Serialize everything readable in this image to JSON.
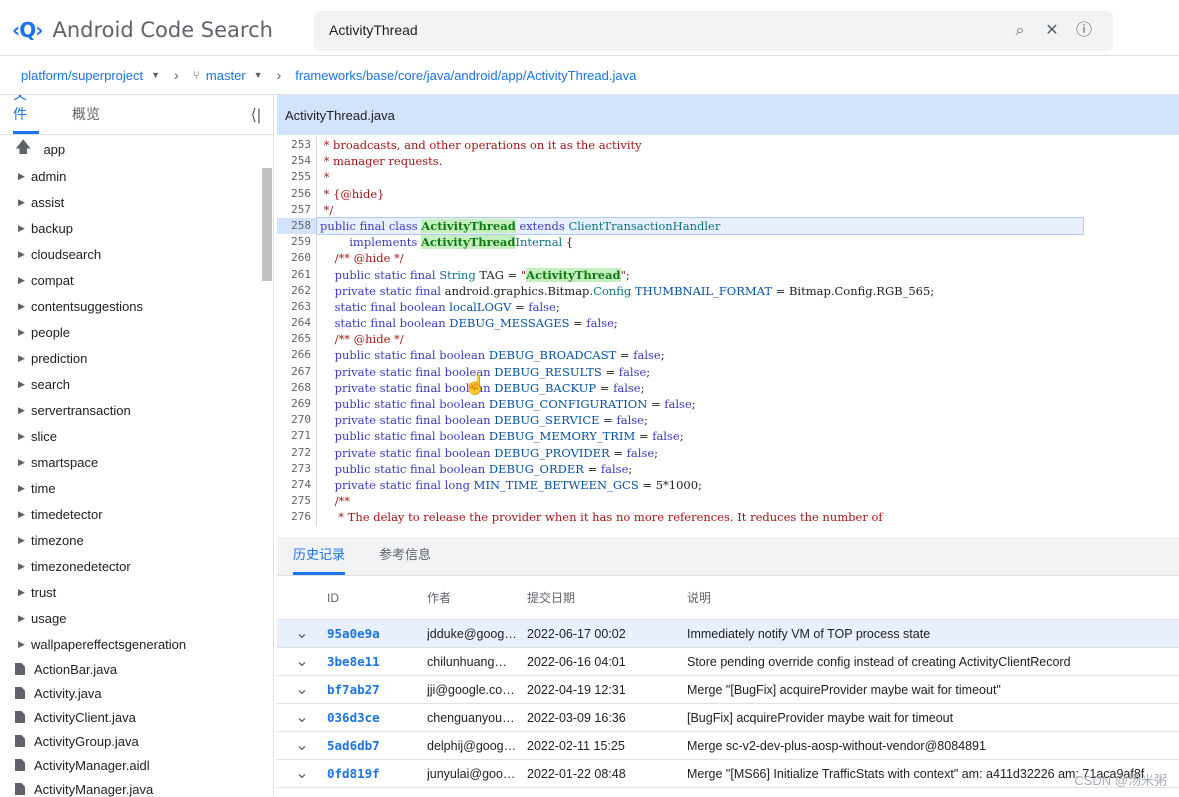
{
  "app": {
    "logo_icon": "‹Q›",
    "title": "Android Code Search"
  },
  "search": {
    "value": "ActivityThread",
    "search_icon": "⌕",
    "clear_icon": "✕",
    "info_icon": "ⓘ"
  },
  "breadcrumb": {
    "project": "platform/superproject",
    "branch": "master",
    "path": "frameworks/base/core/java/android/app/ActivityThread.java"
  },
  "sidebar": {
    "tabs": [
      "文件",
      "概览"
    ],
    "up_label": "app",
    "folders": [
      "admin",
      "assist",
      "backup",
      "cloudsearch",
      "compat",
      "contentsuggestions",
      "people",
      "prediction",
      "search",
      "servertransaction",
      "slice",
      "smartspace",
      "time",
      "timedetector",
      "timezone",
      "timezonedetector",
      "trust",
      "usage",
      "wallpapereffectsgeneration"
    ],
    "files": [
      "ActionBar.java",
      "Activity.java",
      "ActivityClient.java",
      "ActivityGroup.java",
      "ActivityManager.aidl",
      "ActivityManager.java"
    ]
  },
  "file": {
    "name": "ActivityThread.java"
  },
  "code": {
    "lines": [
      {
        "n": "253",
        "html": "<span class='cm'> * broadcasts, and other operations on it as the activity</span>"
      },
      {
        "n": "254",
        "html": "<span class='cm'> * manager requests.</span>"
      },
      {
        "n": "255",
        "html": "<span class='cm'> *</span>"
      },
      {
        "n": "256",
        "html": "<span class='cm'> * {@hide}</span>"
      },
      {
        "n": "257",
        "html": "<span class='cm'> */</span>"
      },
      {
        "n": "258",
        "hl": true,
        "html": "<span class='kw'>public final class</span> <span class='mark'>ActivityThread</span> <span class='kw'>extends</span> <span class='ty'>ClientTransactionHandler</span>"
      },
      {
        "n": "259",
        "html": "        <span class='kw'>implements</span> <span class='mark'>ActivityThread</span><span class='ty'>Internal</span> {"
      },
      {
        "n": "260",
        "html": "    <span class='cm'>/** @hide */</span>"
      },
      {
        "n": "261",
        "html": "    <span class='kw'>public static final</span> <span class='ty'>String</span> TAG = <span class='str'>\"<span class='mark'>ActivityThread</span>\"</span>;"
      },
      {
        "n": "262",
        "html": "    <span class='kw'>private static final</span> android.graphics.Bitmap.<span class='ty'>Config</span> <span class='cn'>THUMBNAIL_FORMAT</span> = Bitmap.Config.RGB_565;"
      },
      {
        "n": "263",
        "html": "    <span class='kw'>static final boolean</span> <span class='cn'>localLOGV</span> = <span class='kw'>false</span>;"
      },
      {
        "n": "264",
        "html": "    <span class='kw'>static final boolean</span> <span class='cn'>DEBUG_MESSAGES</span> = <span class='kw'>false</span>;"
      },
      {
        "n": "265",
        "html": "    <span class='cm'>/** @hide */</span>"
      },
      {
        "n": "266",
        "html": "    <span class='kw'>public static final boolean</span> <span class='cn'>DEBUG_BROADCAST</span> = <span class='kw'>false</span>;"
      },
      {
        "n": "267",
        "html": "    <span class='kw'>private static final boolean</span> <span class='cn'>DEBUG_RESULTS</span> = <span class='kw'>false</span>;"
      },
      {
        "n": "268",
        "html": "    <span class='kw'>private static final boolean</span> <span class='cn'>DEBUG_BACKUP</span> = <span class='kw'>false</span>;"
      },
      {
        "n": "269",
        "html": "    <span class='kw'>public static final boolean</span> <span class='cn'>DEBUG_CONFIGURATION</span> = <span class='kw'>false</span>;"
      },
      {
        "n": "270",
        "html": "    <span class='kw'>private static final boolean</span> <span class='cn'>DEBUG_SERVICE</span> = <span class='kw'>false</span>;"
      },
      {
        "n": "271",
        "html": "    <span class='kw'>public static final boolean</span> <span class='cn'>DEBUG_MEMORY_TRIM</span> = <span class='kw'>false</span>;"
      },
      {
        "n": "272",
        "html": "    <span class='kw'>private static final boolean</span> <span class='cn'>DEBUG_PROVIDER</span> = <span class='kw'>false</span>;"
      },
      {
        "n": "273",
        "html": "    <span class='kw'>public static final boolean</span> <span class='cn'>DEBUG_ORDER</span> = <span class='kw'>false</span>;"
      },
      {
        "n": "274",
        "html": "    <span class='kw'>private static final long</span> <span class='cn'>MIN_TIME_BETWEEN_GCS</span> = 5*1000;"
      },
      {
        "n": "275",
        "html": "    <span class='cm'>/**</span>"
      },
      {
        "n": "276",
        "html": "<span class='cm'>     * The delay to release the provider when it has no more references. It reduces the number of</span>"
      }
    ]
  },
  "history": {
    "tabs": [
      "历史记录",
      "参考信息"
    ],
    "headers": {
      "id": "ID",
      "author": "作者",
      "date": "提交日期",
      "desc": "说明"
    },
    "rows": [
      {
        "id": "95a0e9a",
        "author": "jdduke@goog…",
        "date": "2022-06-17 00:02",
        "desc": "Immediately notify VM of TOP process state",
        "sel": true
      },
      {
        "id": "3be8e11",
        "author": "chilunhuang…",
        "date": "2022-06-16 04:01",
        "desc": "Store pending override config instead of creating ActivityClientRecord"
      },
      {
        "id": "bf7ab27",
        "author": "jji@google.co…",
        "date": "2022-04-19 12:31",
        "desc": "Merge \"[BugFix] acquireProvider maybe wait for timeout\""
      },
      {
        "id": "036d3ce",
        "author": "chenguanyou…",
        "date": "2022-03-09 16:36",
        "desc": "[BugFix] acquireProvider maybe wait for timeout"
      },
      {
        "id": "5ad6db7",
        "author": "delphij@goog…",
        "date": "2022-02-11 15:25",
        "desc": "Merge sc-v2-dev-plus-aosp-without-vendor@8084891"
      },
      {
        "id": "0fd819f",
        "author": "junyulai@goo…",
        "date": "2022-01-22 08:48",
        "desc": "Merge \"[MS66] Initialize TrafficStats with context\" am: a411d32226 am: 71aca9af8f"
      }
    ]
  },
  "watermark": "CSDN @汤米粥"
}
